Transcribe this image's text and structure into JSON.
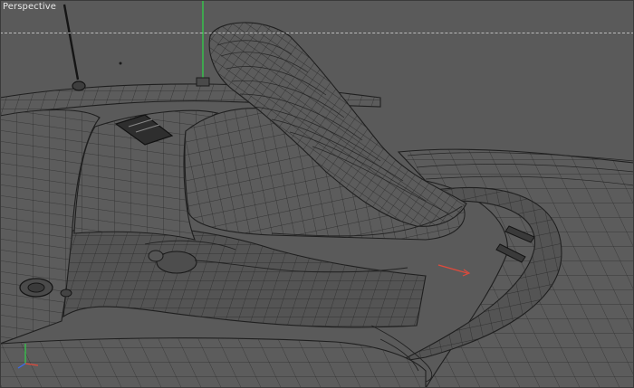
{
  "viewport": {
    "label": "Perspective"
  },
  "axis": {
    "x_color": "#e04a3c",
    "y_color": "#34c84a",
    "z_color": "#3a6cf0"
  }
}
